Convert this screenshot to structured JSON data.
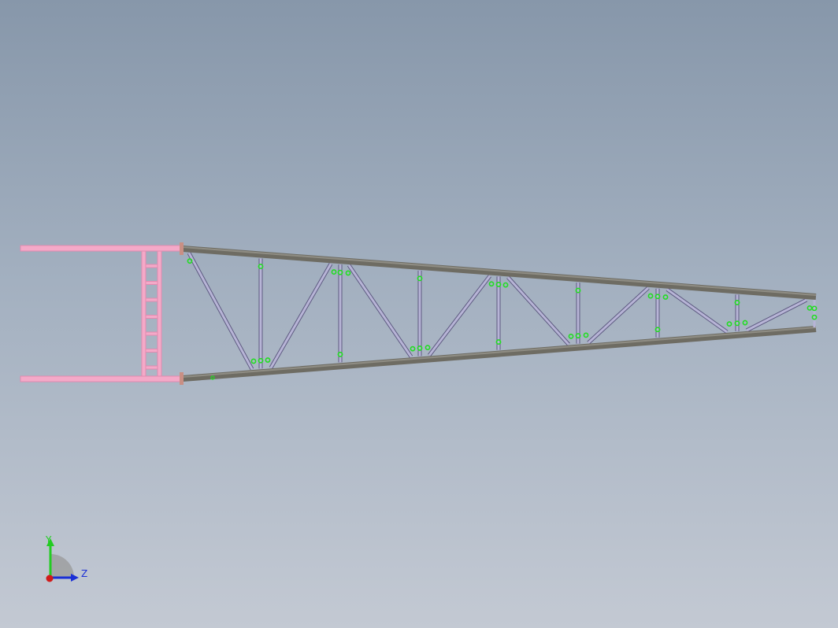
{
  "viewport": {
    "background_top": "#8797aa",
    "background_bottom": "#c3c9d3"
  },
  "colors": {
    "chord": "#6e6c63",
    "chord_highlight": "#8f8d84",
    "web_member": "#b7b4d6",
    "web_edge": "#5d5a80",
    "ladder": "#f4a9c8",
    "ladder_edge": "#e28ab0",
    "weld_mark": "#22dd22",
    "end_plate": "#c98f84"
  },
  "model": {
    "type": "tapered-truss-beam",
    "panels": 8,
    "web_members": 16,
    "ladder_rungs": 7
  },
  "triad": {
    "y_label": "Y",
    "z_label": "Z",
    "x_color": "#d11a1a",
    "y_color": "#22cc22",
    "z_color": "#1a2fd6"
  }
}
